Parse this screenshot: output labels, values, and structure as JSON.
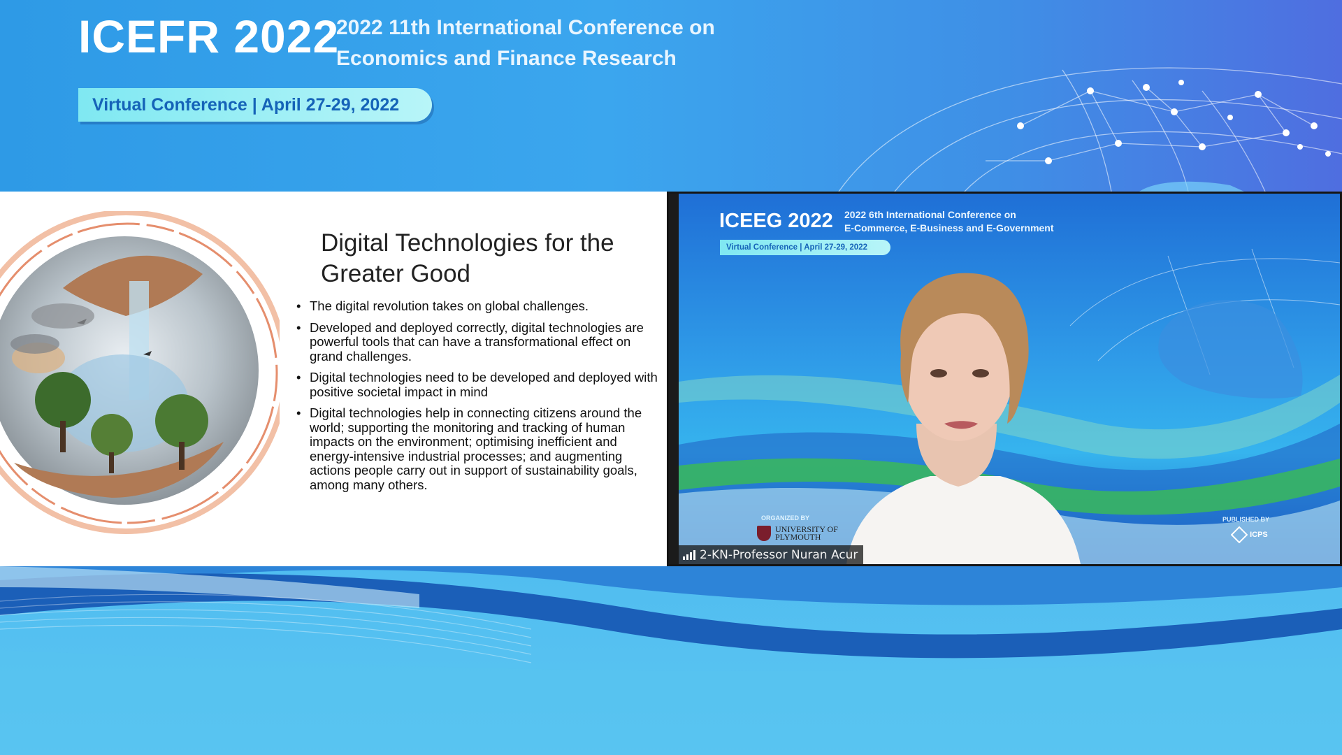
{
  "banner": {
    "acronym": "ICEFR 2022",
    "title_line1": "2022 11th International Conference on",
    "title_line2": "Economics and Finance Research",
    "pill": "Virtual Conference | April 27-29, 2022"
  },
  "slide": {
    "title_line1": "Digital Technologies for the",
    "title_line2": "Greater Good",
    "bullets": [
      "The digital revolution takes on global challenges.",
      "Developed and deployed correctly, digital technologies are powerful tools that can have a transformational effect on grand challenges.",
      "Digital technologies need to be developed and deployed with positive societal impact in mind",
      "Digital technologies help in connecting citizens around the world; supporting the monitoring and tracking of human impacts on the environment; optimising inefficient and energy-intensive industrial processes; and augmenting actions people carry out in support of sustainability goals, among many others."
    ]
  },
  "video": {
    "acronym": "ICEEG 2022",
    "title_line1": "2022 6th International Conference on",
    "title_line2": "E-Commerce, E-Business and E-Government",
    "pill": "Virtual Conference | April 27-29, 2022",
    "organized_by": "ORGANIZED BY",
    "university_line1": "UNIVERSITY OF",
    "university_line2": "PLYMOUTH",
    "published_by": "PUBLISHED BY",
    "publisher_logo": "ICPS",
    "participant_name": "2-KN-Professor Nuran Acur",
    "signal_icon": "signal-bars-icon"
  }
}
